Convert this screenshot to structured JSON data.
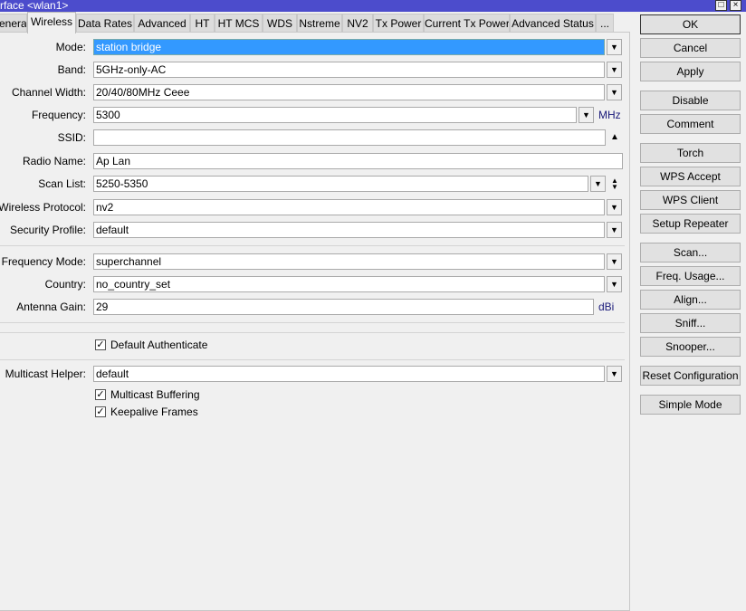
{
  "window": {
    "title": "rface <wlan1>"
  },
  "tabs": [
    "eneral",
    "Wireless",
    "Data Rates",
    "Advanced",
    "HT",
    "HT MCS",
    "WDS",
    "Nstreme",
    "NV2",
    "Tx Power",
    "Current Tx Power",
    "Advanced Status",
    "..."
  ],
  "active_tab": "Wireless",
  "fields": {
    "mode": {
      "label": "Mode:",
      "value": "station bridge"
    },
    "band": {
      "label": "Band:",
      "value": "5GHz-only-AC"
    },
    "channel_width": {
      "label": "Channel Width:",
      "value": "20/40/80MHz Ceee"
    },
    "frequency": {
      "label": "Frequency:",
      "value": "5300",
      "unit": "MHz"
    },
    "ssid": {
      "label": "SSID:",
      "value": ""
    },
    "radio_name": {
      "label": "Radio Name:",
      "value": "Ap Lan"
    },
    "scan_list": {
      "label": "Scan List:",
      "value": "5250-5350"
    },
    "wireless_protocol": {
      "label": "Wireless Protocol:",
      "value": "nv2"
    },
    "security_profile": {
      "label": "Security Profile:",
      "value": "default"
    },
    "frequency_mode": {
      "label": "Frequency Mode:",
      "value": "superchannel"
    },
    "country": {
      "label": "Country:",
      "value": "no_country_set"
    },
    "antenna_gain": {
      "label": "Antenna Gain:",
      "value": "29",
      "unit": "dBi"
    },
    "multicast_helper": {
      "label": "Multicast Helper:",
      "value": "default"
    }
  },
  "checkboxes": {
    "default_authenticate": {
      "label": "Default Authenticate",
      "checked": true
    },
    "multicast_buffering": {
      "label": "Multicast Buffering",
      "checked": true
    },
    "keepalive_frames": {
      "label": "Keepalive Frames",
      "checked": true
    }
  },
  "buttons": [
    "OK",
    "Cancel",
    "Apply",
    "Disable",
    "Comment",
    "Torch",
    "WPS Accept",
    "WPS Client",
    "Setup Repeater",
    "Scan...",
    "Freq. Usage...",
    "Align...",
    "Sniff...",
    "Snooper...",
    "Reset Configuration",
    "Simple Mode"
  ],
  "colors": {
    "titlebar": "#4c4ccc",
    "selection": "#3399ff"
  }
}
